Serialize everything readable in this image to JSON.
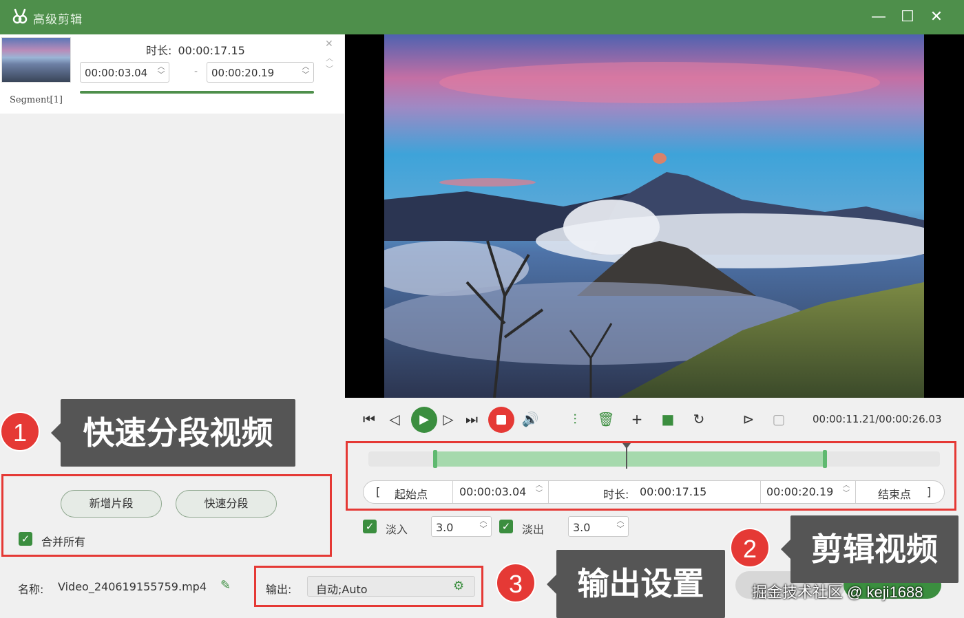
{
  "window": {
    "title": "高级剪辑",
    "minimize": "—",
    "maximize": "☐",
    "close": "✕"
  },
  "segment": {
    "name": "Segment[1]",
    "duration_label": "时长:",
    "duration": "00:00:17.15",
    "start": "00:00:03.04",
    "end": "00:00:20.19",
    "separator": "-"
  },
  "player": {
    "timecode": "00:00:11.21/00:00:26.03"
  },
  "timeline": {
    "start_bracket": "[",
    "start_label": "起始点",
    "start_value": "00:00:03.04",
    "duration_label": "时长:",
    "duration_value": "00:00:17.15",
    "end_value": "00:00:20.19",
    "end_label": "结束点",
    "end_bracket": "]"
  },
  "fade": {
    "fade_in_label": "淡入",
    "fade_in_value": "3.0",
    "fade_out_label": "淡出",
    "fade_out_value": "3.0"
  },
  "left_actions": {
    "add_segment": "新增片段",
    "quick_split": "快速分段",
    "merge_all": "合并所有"
  },
  "file": {
    "name_label": "名称:",
    "name_value": "Video_240619155759.mp4"
  },
  "output": {
    "label": "输出:",
    "value": "自动;Auto"
  },
  "annotations": {
    "badge1": "1",
    "callout1": "快速分段视频",
    "badge2": "2",
    "callout2": "剪辑视频",
    "badge3": "3",
    "callout3": "输出设置"
  },
  "watermark": "掘金技术社区 @ keji1688",
  "colors": {
    "brand_green": "#4e8f4b",
    "accent_green": "#3b8e3f",
    "selection_green": "#a6d9ad",
    "annotation_red": "#e53935",
    "callout_gray": "#555555"
  }
}
